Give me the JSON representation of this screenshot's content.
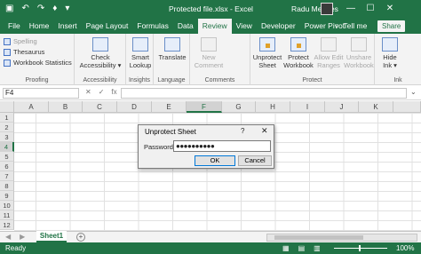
{
  "window": {
    "title": "Protected file.xlsx  -  Excel",
    "user": "Radu Meghes",
    "controls": [
      "—",
      "☐",
      "✕"
    ]
  },
  "qat": {
    "icons": [
      "save-icon",
      "undo-icon",
      "redo-icon",
      "lightbulb-icon",
      "customize-icon"
    ]
  },
  "tabs": [
    "File",
    "Home",
    "Insert",
    "Page Layout",
    "Formulas",
    "Data",
    "Review",
    "View",
    "Developer",
    "Power Pivot"
  ],
  "active_tab": "Review",
  "tellme": "Tell me",
  "share": "Share",
  "ribbon": {
    "proofing": {
      "label": "Proofing",
      "spelling": "Spelling",
      "thesaurus": "Thesaurus",
      "workbook_statistics": "Workbook Statistics"
    },
    "accessibility": {
      "label": "Accessibility",
      "check_line1": "Check",
      "check_line2": "Accessibility ▾"
    },
    "insights": {
      "label": "Insights",
      "line1": "Smart",
      "line2": "Lookup"
    },
    "language": {
      "label": "Language",
      "translate": "Translate"
    },
    "comments": {
      "label": "Comments",
      "line1": "New",
      "line2": "Comment"
    },
    "protect": {
      "label": "Protect",
      "unprotect_sheet_1": "Unprotect",
      "unprotect_sheet_2": "Sheet",
      "protect_workbook_1": "Protect",
      "protect_workbook_2": "Workbook",
      "allow_edit_1": "Allow Edit",
      "allow_edit_2": "Ranges",
      "unshare_1": "Unshare",
      "unshare_2": "Workbook"
    },
    "ink": {
      "label": "Ink",
      "line1": "Hide",
      "line2": "Ink ▾"
    }
  },
  "formula_bar": {
    "name_box": "F4",
    "cancel": "✕",
    "enter": "✓",
    "fx": "fx",
    "value": ""
  },
  "columns": [
    "A",
    "B",
    "C",
    "D",
    "E",
    "F",
    "G",
    "H",
    "I",
    "J",
    "K"
  ],
  "rows": [
    "1",
    "2",
    "3",
    "4",
    "5",
    "6",
    "7",
    "8",
    "9",
    "10",
    "11",
    "12"
  ],
  "selected_column": "F",
  "selected_row": "4",
  "dialog": {
    "title": "Unprotect Sheet",
    "help": "?",
    "close": "✕",
    "password_label": "Password:",
    "password_value": "●●●●●●●●●●",
    "ok": "OK",
    "cancel": "Cancel"
  },
  "sheets": {
    "active": "Sheet1",
    "add": "+",
    "nav_prev": "◀",
    "nav_next": "▶"
  },
  "status": {
    "text": "Ready",
    "zoom": "100%"
  },
  "colors": {
    "excel_green": "#217346"
  }
}
